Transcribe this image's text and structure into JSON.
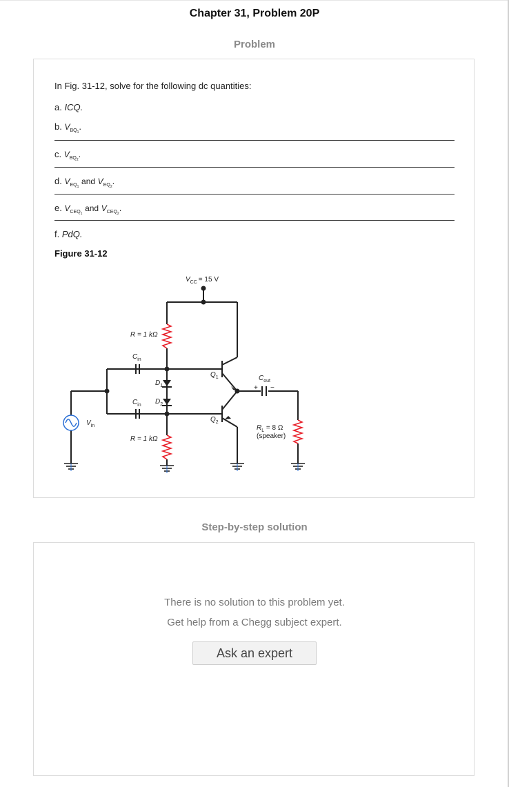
{
  "header": {
    "chapter_title": "Chapter 31, Problem 20P",
    "problem_heading": "Problem",
    "solution_heading": "Step-by-step solution"
  },
  "problem": {
    "intro": "In Fig. 31-12, solve for the following dc quantities:",
    "parts": {
      "a": {
        "letter": "a.",
        "text": "ICQ."
      },
      "b": {
        "letter": "b.",
        "v": "V",
        "sub": "BQ",
        "subsub": "1",
        "end": "."
      },
      "c": {
        "letter": "c.",
        "v": "V",
        "sub": "BQ",
        "subsub": "2",
        "end": "."
      },
      "d": {
        "letter": "d.",
        "v1": "V",
        "sub1": "EQ",
        "subsub1": "1",
        "joiner": "and",
        "v2": "V",
        "sub2": "EQ",
        "subsub2": "2",
        "end": "."
      },
      "e": {
        "letter": "e.",
        "v1": "V",
        "sub1": "CEQ",
        "subsub1": "1",
        "joiner": "and",
        "v2": "V",
        "sub2": "CEQ",
        "subsub2": "2",
        "end": "."
      },
      "f": {
        "letter": "f.",
        "text": "PdQ."
      }
    },
    "figure_label": "Figure 31-12"
  },
  "figure": {
    "vcc": {
      "sym": "V",
      "sub": "CC",
      "value": "= 15 V"
    },
    "r_top": "R = 1 kΩ",
    "r_bottom": "R = 1 kΩ",
    "cin_top": {
      "sym": "C",
      "sub": "in"
    },
    "cin_bottom": {
      "sym": "C",
      "sub": "in"
    },
    "d1": {
      "sym": "D",
      "sub": "1"
    },
    "d2": {
      "sym": "D",
      "sub": "2"
    },
    "q1": {
      "sym": "Q",
      "sub": "1"
    },
    "q2": {
      "sym": "Q",
      "sub": "2"
    },
    "cout": {
      "sym": "C",
      "sub": "out"
    },
    "vin": {
      "sym": "V",
      "sub": "in"
    },
    "rl": {
      "sym": "R",
      "sub": "L",
      "value": " = 8 Ω"
    },
    "speaker": "(speaker)",
    "resistor_color": "#e8202a"
  },
  "solution": {
    "line1": "There is no solution to this problem yet.",
    "line2": "Get help from a Chegg subject expert.",
    "button_label": "Ask an expert"
  }
}
